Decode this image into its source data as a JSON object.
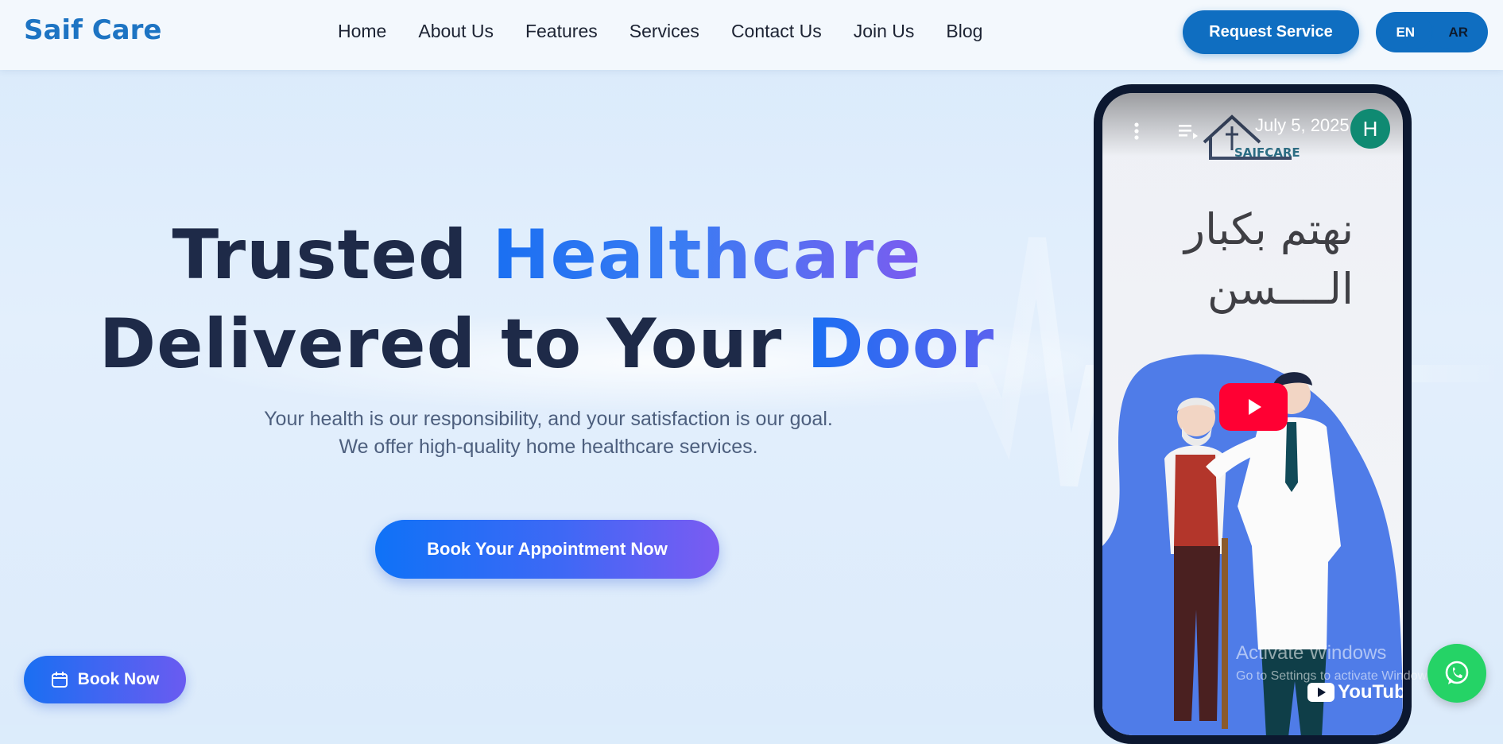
{
  "brand": {
    "name": "Saif Care",
    "color": "#1d74c3"
  },
  "nav": {
    "items": [
      "Home",
      "About Us",
      "Features",
      "Services",
      "Contact Us",
      "Join Us",
      "Blog"
    ]
  },
  "header": {
    "request_label": "Request Service",
    "lang_en": "EN",
    "lang_ar": "AR"
  },
  "hero": {
    "line1_plain": "Trusted ",
    "line1_accent": "Healthcare",
    "line2_plain": "Delivered to Your ",
    "line2_accent": "Door",
    "subtitle": "Your health is our responsibility, and your satisfaction is our goal. We offer high-quality home healthcare services.",
    "cta_label": "Book Your Appointment Now"
  },
  "floating": {
    "book_now_label": "Book Now",
    "book_icon": "calendar-icon",
    "whatsapp_icon": "whatsapp-icon"
  },
  "video": {
    "date": "July 5, 2025",
    "avatar_initial": "H",
    "logo_text": "SAIFCARE",
    "arabic_line1": "نهتم بكبار",
    "arabic_line2": "الــــسن",
    "brand": "YouTube",
    "menu_icon": "more-vert-icon",
    "playlist_icon": "playlist-icon",
    "play_icon": "play-icon"
  },
  "overlay": {
    "activate_title": "Activate Windows",
    "activate_sub": "Go to Settings to activate Windows."
  },
  "colors": {
    "primary": "#0f6ec1",
    "dark_text": "#1e2a48",
    "gradient_start": "#1a6ff2",
    "gradient_end": "#7b5cf0",
    "whatsapp": "#25d366",
    "youtube": "#ff0033"
  }
}
